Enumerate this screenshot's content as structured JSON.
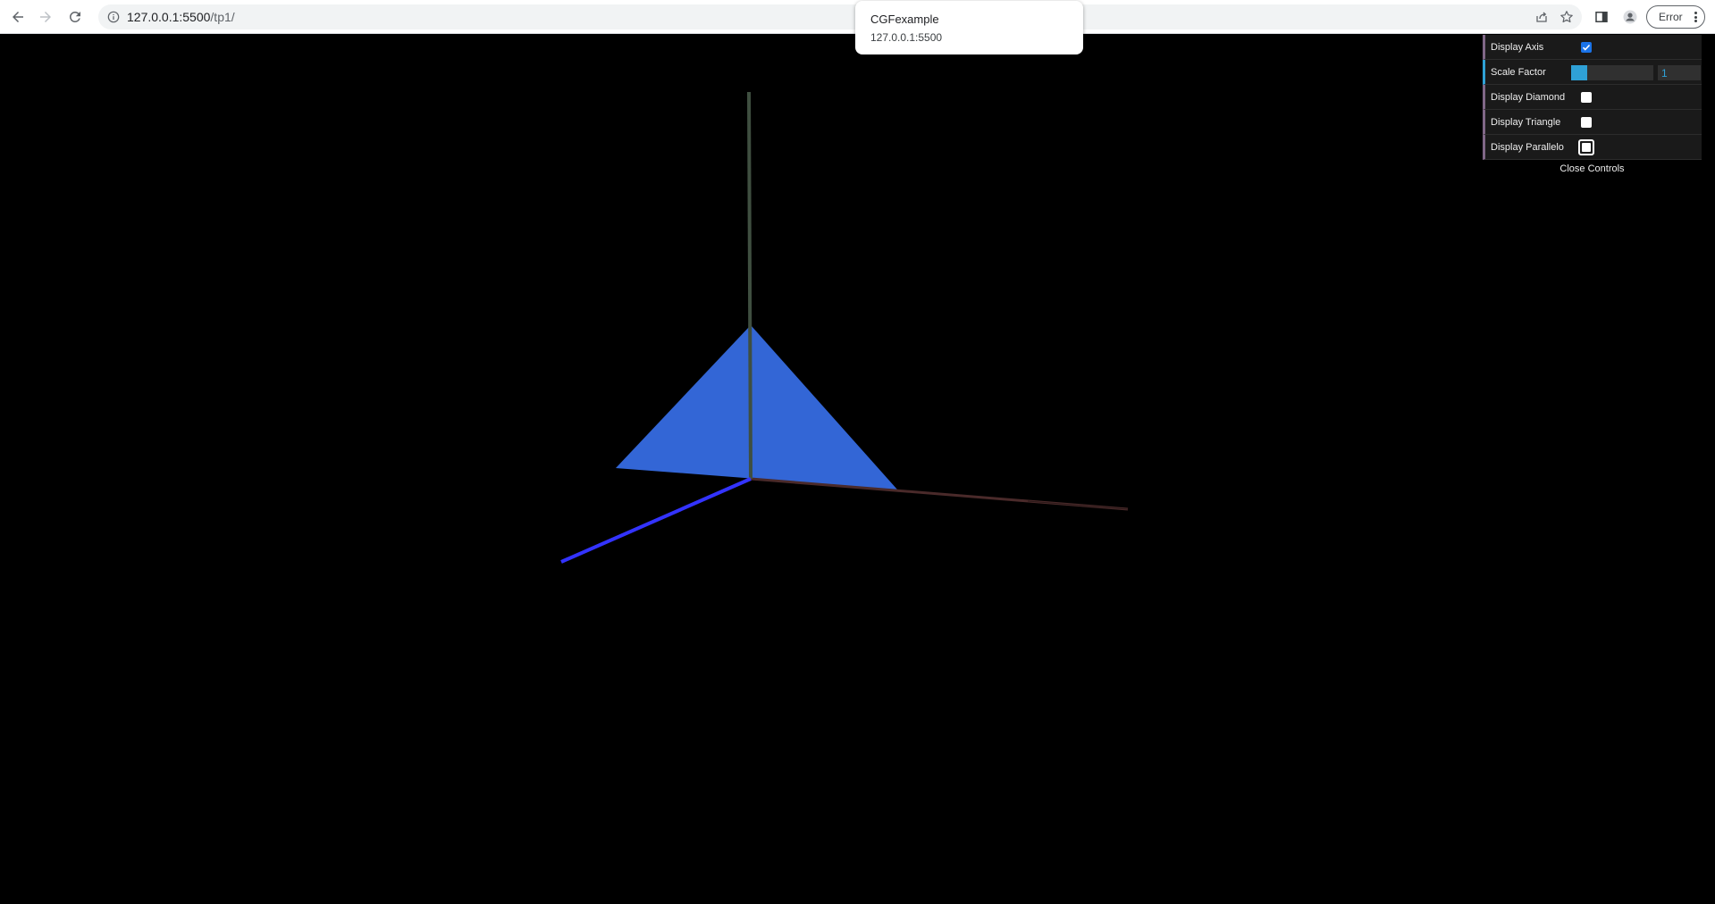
{
  "browser": {
    "url_host": "127.0.0.1:5500",
    "url_path": "/tp1/",
    "profile_status": "Error"
  },
  "tooltip": {
    "title": "CGFexample",
    "origin": "127.0.0.1:5500"
  },
  "gui": {
    "controls": [
      {
        "label": "Display Axis",
        "type": "checkbox",
        "checked": true
      },
      {
        "label": "Scale Factor",
        "type": "number",
        "value": "1",
        "slider_fraction": 0.2
      },
      {
        "label": "Display Diamond",
        "type": "checkbox",
        "checked": false
      },
      {
        "label": "Display Triangle",
        "type": "checkbox",
        "checked": false
      },
      {
        "label": "Display Parallelo",
        "type": "checkbox",
        "checked": false,
        "focused": true
      }
    ],
    "close_label": "Close Controls"
  },
  "scene": {
    "background_color": "#000000",
    "shape_color": "#3366d6",
    "axis_colors": {
      "x": "#4a2a2a",
      "y": "#3a4a3a",
      "z": "#3333ff"
    }
  }
}
